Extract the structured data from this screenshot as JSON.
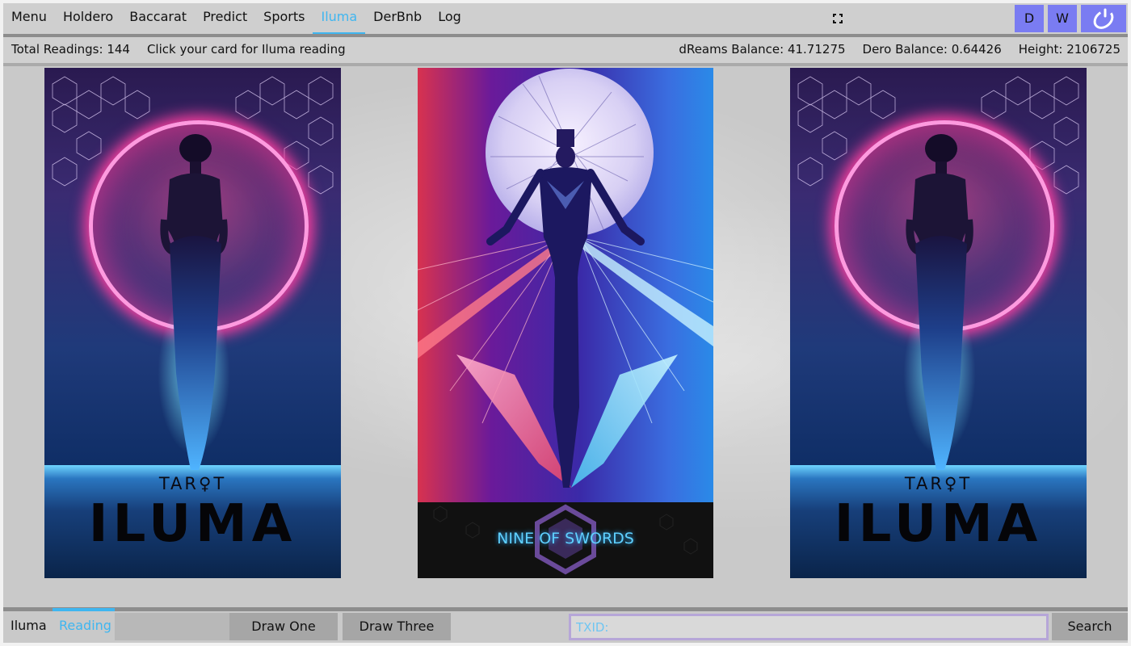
{
  "nav": {
    "tabs": [
      "Menu",
      "Holdero",
      "Baccarat",
      "Predict",
      "Sports",
      "Iluma",
      "DerBnb",
      "Log"
    ],
    "active_tab": "Iluma",
    "d_button": "D",
    "w_button": "W"
  },
  "info": {
    "total_readings": "Total Readings: 144",
    "hint": "Click your card for Iluma reading",
    "dreams_balance": "dReams Balance: 41.71275",
    "dero_balance": "Dero Balance: 0.64426",
    "height": "Height: 2106725"
  },
  "cards": {
    "left": {
      "tarot": "TAR♀T",
      "title": "ILUMA"
    },
    "middle": {
      "name": "NINE OF SWORDS"
    },
    "right": {
      "tarot": "TAR♀T",
      "title": "ILUMA"
    }
  },
  "bottom": {
    "tab_iluma": "Iluma",
    "tab_reading": "Reading",
    "draw_one": "Draw One",
    "draw_three": "Draw Three",
    "txid_placeholder": "TXID:",
    "search": "Search"
  },
  "colors": {
    "accent": "#3fb6f0",
    "wallet_buttons": "#7a7cf2",
    "background": "#c9c9c9"
  },
  "icons": [
    "fullscreen-icon",
    "power-icon"
  ]
}
